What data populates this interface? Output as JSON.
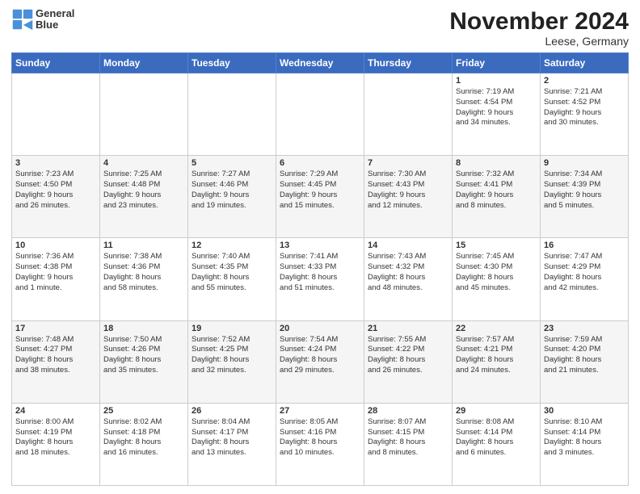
{
  "logo": {
    "line1": "General",
    "line2": "Blue"
  },
  "title": "November 2024",
  "subtitle": "Leese, Germany",
  "days_header": [
    "Sunday",
    "Monday",
    "Tuesday",
    "Wednesday",
    "Thursday",
    "Friday",
    "Saturday"
  ],
  "weeks": [
    [
      {
        "day": "",
        "info": ""
      },
      {
        "day": "",
        "info": ""
      },
      {
        "day": "",
        "info": ""
      },
      {
        "day": "",
        "info": ""
      },
      {
        "day": "",
        "info": ""
      },
      {
        "day": "1",
        "info": "Sunrise: 7:19 AM\nSunset: 4:54 PM\nDaylight: 9 hours\nand 34 minutes."
      },
      {
        "day": "2",
        "info": "Sunrise: 7:21 AM\nSunset: 4:52 PM\nDaylight: 9 hours\nand 30 minutes."
      }
    ],
    [
      {
        "day": "3",
        "info": "Sunrise: 7:23 AM\nSunset: 4:50 PM\nDaylight: 9 hours\nand 26 minutes."
      },
      {
        "day": "4",
        "info": "Sunrise: 7:25 AM\nSunset: 4:48 PM\nDaylight: 9 hours\nand 23 minutes."
      },
      {
        "day": "5",
        "info": "Sunrise: 7:27 AM\nSunset: 4:46 PM\nDaylight: 9 hours\nand 19 minutes."
      },
      {
        "day": "6",
        "info": "Sunrise: 7:29 AM\nSunset: 4:45 PM\nDaylight: 9 hours\nand 15 minutes."
      },
      {
        "day": "7",
        "info": "Sunrise: 7:30 AM\nSunset: 4:43 PM\nDaylight: 9 hours\nand 12 minutes."
      },
      {
        "day": "8",
        "info": "Sunrise: 7:32 AM\nSunset: 4:41 PM\nDaylight: 9 hours\nand 8 minutes."
      },
      {
        "day": "9",
        "info": "Sunrise: 7:34 AM\nSunset: 4:39 PM\nDaylight: 9 hours\nand 5 minutes."
      }
    ],
    [
      {
        "day": "10",
        "info": "Sunrise: 7:36 AM\nSunset: 4:38 PM\nDaylight: 9 hours\nand 1 minute."
      },
      {
        "day": "11",
        "info": "Sunrise: 7:38 AM\nSunset: 4:36 PM\nDaylight: 8 hours\nand 58 minutes."
      },
      {
        "day": "12",
        "info": "Sunrise: 7:40 AM\nSunset: 4:35 PM\nDaylight: 8 hours\nand 55 minutes."
      },
      {
        "day": "13",
        "info": "Sunrise: 7:41 AM\nSunset: 4:33 PM\nDaylight: 8 hours\nand 51 minutes."
      },
      {
        "day": "14",
        "info": "Sunrise: 7:43 AM\nSunset: 4:32 PM\nDaylight: 8 hours\nand 48 minutes."
      },
      {
        "day": "15",
        "info": "Sunrise: 7:45 AM\nSunset: 4:30 PM\nDaylight: 8 hours\nand 45 minutes."
      },
      {
        "day": "16",
        "info": "Sunrise: 7:47 AM\nSunset: 4:29 PM\nDaylight: 8 hours\nand 42 minutes."
      }
    ],
    [
      {
        "day": "17",
        "info": "Sunrise: 7:48 AM\nSunset: 4:27 PM\nDaylight: 8 hours\nand 38 minutes."
      },
      {
        "day": "18",
        "info": "Sunrise: 7:50 AM\nSunset: 4:26 PM\nDaylight: 8 hours\nand 35 minutes."
      },
      {
        "day": "19",
        "info": "Sunrise: 7:52 AM\nSunset: 4:25 PM\nDaylight: 8 hours\nand 32 minutes."
      },
      {
        "day": "20",
        "info": "Sunrise: 7:54 AM\nSunset: 4:24 PM\nDaylight: 8 hours\nand 29 minutes."
      },
      {
        "day": "21",
        "info": "Sunrise: 7:55 AM\nSunset: 4:22 PM\nDaylight: 8 hours\nand 26 minutes."
      },
      {
        "day": "22",
        "info": "Sunrise: 7:57 AM\nSunset: 4:21 PM\nDaylight: 8 hours\nand 24 minutes."
      },
      {
        "day": "23",
        "info": "Sunrise: 7:59 AM\nSunset: 4:20 PM\nDaylight: 8 hours\nand 21 minutes."
      }
    ],
    [
      {
        "day": "24",
        "info": "Sunrise: 8:00 AM\nSunset: 4:19 PM\nDaylight: 8 hours\nand 18 minutes."
      },
      {
        "day": "25",
        "info": "Sunrise: 8:02 AM\nSunset: 4:18 PM\nDaylight: 8 hours\nand 16 minutes."
      },
      {
        "day": "26",
        "info": "Sunrise: 8:04 AM\nSunset: 4:17 PM\nDaylight: 8 hours\nand 13 minutes."
      },
      {
        "day": "27",
        "info": "Sunrise: 8:05 AM\nSunset: 4:16 PM\nDaylight: 8 hours\nand 10 minutes."
      },
      {
        "day": "28",
        "info": "Sunrise: 8:07 AM\nSunset: 4:15 PM\nDaylight: 8 hours\nand 8 minutes."
      },
      {
        "day": "29",
        "info": "Sunrise: 8:08 AM\nSunset: 4:14 PM\nDaylight: 8 hours\nand 6 minutes."
      },
      {
        "day": "30",
        "info": "Sunrise: 8:10 AM\nSunset: 4:14 PM\nDaylight: 8 hours\nand 3 minutes."
      }
    ]
  ]
}
